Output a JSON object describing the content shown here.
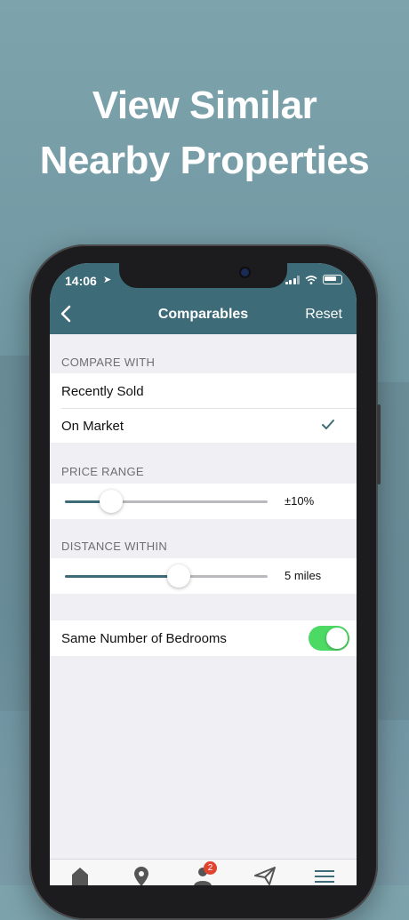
{
  "headline": {
    "line1": "View Similar",
    "line2": "Nearby Properties"
  },
  "status": {
    "time": "14:06"
  },
  "nav": {
    "title": "Comparables",
    "reset_label": "Reset"
  },
  "compare": {
    "header": "COMPARE WITH",
    "options": [
      {
        "label": "Recently Sold",
        "selected": false
      },
      {
        "label": "On Market",
        "selected": true
      }
    ]
  },
  "price_range": {
    "header": "PRICE RANGE",
    "value_label": "±10%",
    "level": 0.23
  },
  "distance": {
    "header": "DISTANCE WITHIN",
    "value_label": "5 miles",
    "level": 0.56
  },
  "bedrooms": {
    "label": "Same Number of Bedrooms",
    "enabled": true
  },
  "tabbar": {
    "items": [
      "home-icon",
      "map-pin-icon",
      "profile-icon",
      "plane-icon",
      "menu-icon"
    ],
    "badge": "2"
  },
  "colors": {
    "accent": "#3d6b78",
    "toggle_on": "#4cd964",
    "badge": "#e0442f"
  }
}
